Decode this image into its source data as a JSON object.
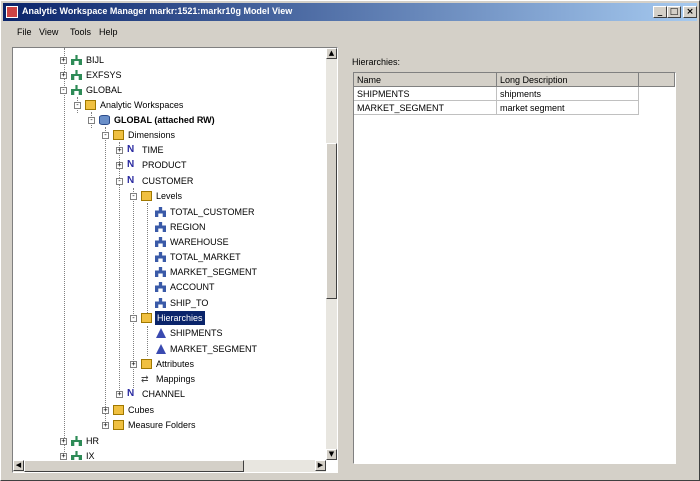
{
  "window": {
    "title": "Analytic Workspace Manager  markr:1521:markr10g  Model View",
    "buttons": {
      "minimize": "_",
      "maximize": "□",
      "close": "×"
    }
  },
  "menu": [
    "File",
    "View",
    "Tools",
    "Help"
  ],
  "tree": [
    {
      "label": "BIJL",
      "icon": "network-icon",
      "toggle": "+"
    },
    {
      "label": "EXFSYS",
      "icon": "network-icon",
      "toggle": "+"
    },
    {
      "label": "GLOBAL",
      "icon": "network-icon",
      "toggle": "-"
    },
    {
      "label": "Analytic Workspaces",
      "icon": "folder-icon",
      "toggle": "-"
    },
    {
      "label": "GLOBAL (attached RW)",
      "icon": "database-icon",
      "toggle": "-"
    },
    {
      "label": "Dimensions",
      "icon": "folder-icon",
      "toggle": "-"
    },
    {
      "label": "TIME",
      "icon": "dimension-icon",
      "toggle": "+"
    },
    {
      "label": "PRODUCT",
      "icon": "dimension-icon",
      "toggle": "+"
    },
    {
      "label": "CUSTOMER",
      "icon": "dimension-icon",
      "toggle": "-"
    },
    {
      "label": "Levels",
      "icon": "folder-icon",
      "toggle": "-"
    },
    {
      "label": "TOTAL_CUSTOMER",
      "icon": "level-icon",
      "toggle": ""
    },
    {
      "label": "REGION",
      "icon": "level-icon",
      "toggle": ""
    },
    {
      "label": "WAREHOUSE",
      "icon": "level-icon",
      "toggle": ""
    },
    {
      "label": "TOTAL_MARKET",
      "icon": "level-icon",
      "toggle": ""
    },
    {
      "label": "MARKET_SEGMENT",
      "icon": "level-icon",
      "toggle": ""
    },
    {
      "label": "ACCOUNT",
      "icon": "level-icon",
      "toggle": ""
    },
    {
      "label": "SHIP_TO",
      "icon": "level-icon",
      "toggle": ""
    },
    {
      "label": "Hierarchies",
      "icon": "folder-icon",
      "toggle": "-",
      "selected": true
    },
    {
      "label": "SHIPMENTS",
      "icon": "hierarchy-icon",
      "toggle": ""
    },
    {
      "label": "MARKET_SEGMENT",
      "icon": "hierarchy-icon",
      "toggle": ""
    },
    {
      "label": "Attributes",
      "icon": "attributes-icon",
      "toggle": "+"
    },
    {
      "label": "Mappings",
      "icon": "mappings-icon",
      "toggle": ""
    },
    {
      "label": "CHANNEL",
      "icon": "dimension-icon",
      "toggle": "+"
    },
    {
      "label": "Cubes",
      "icon": "folder-icon",
      "toggle": "+"
    },
    {
      "label": "Measure Folders",
      "icon": "folder-icon",
      "toggle": "+"
    },
    {
      "label": "HR",
      "icon": "network-icon",
      "toggle": "+"
    },
    {
      "label": "IX",
      "icon": "network-icon",
      "toggle": "+"
    }
  ],
  "right": {
    "heading": "Hierarchies:",
    "columns": [
      "Name",
      "Long Description"
    ],
    "rows": [
      [
        "SHIPMENTS",
        "shipments"
      ],
      [
        "MARKET_SEGMENT",
        "market segment"
      ]
    ]
  }
}
